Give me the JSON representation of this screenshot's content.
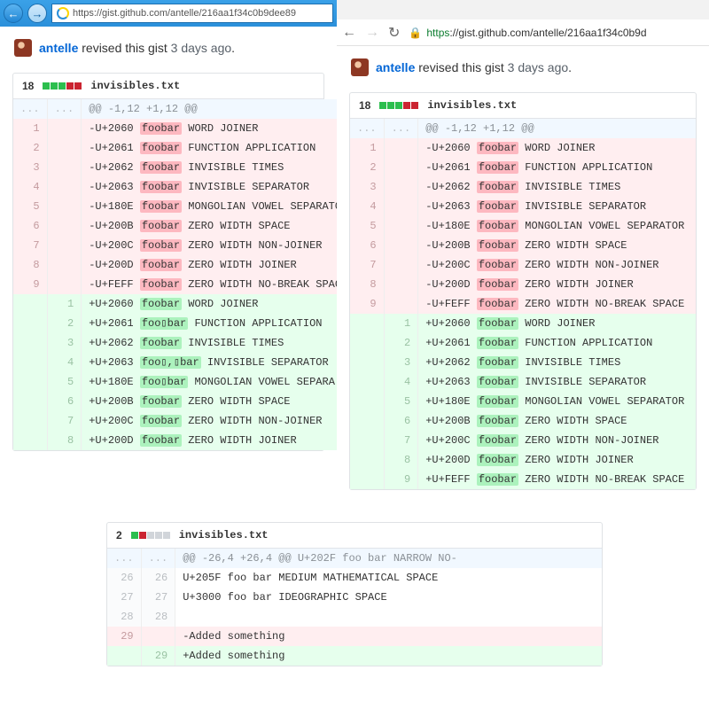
{
  "url_full": "https://gist.github.com/antelle/216aa1f34c0b9dee89",
  "url_partial": "https://gist.github.com/antelle/216aa1f34c0b9d",
  "author": "antelle",
  "revised_text": "revised",
  "gist_text": "this gist",
  "ago": "3 days ago",
  "dot": ".",
  "file1": {
    "stat": "18",
    "name": "invisibles.txt",
    "hunk": "@@ -1,12 +1,12 @@"
  },
  "del": [
    {
      "n": "1",
      "code": "U+2060",
      "label": "WORD JOINER"
    },
    {
      "n": "2",
      "code": "U+2061",
      "label": "FUNCTION APPLICATION"
    },
    {
      "n": "3",
      "code": "U+2062",
      "label": "INVISIBLE TIMES"
    },
    {
      "n": "4",
      "code": "U+2063",
      "label": "INVISIBLE SEPARATOR"
    },
    {
      "n": "5",
      "code": "U+180E",
      "label": "MONGOLIAN VOWEL SEPARATOR"
    },
    {
      "n": "6",
      "code": "U+200B",
      "label": "ZERO WIDTH SPACE"
    },
    {
      "n": "7",
      "code": "U+200C",
      "label": "ZERO WIDTH NON-JOINER"
    },
    {
      "n": "8",
      "code": "U+200D",
      "label": "ZERO WIDTH JOINER"
    },
    {
      "n": "9",
      "code": "U+FEFF",
      "label": "ZERO WIDTH NO-BREAK SPACE"
    }
  ],
  "add_left": [
    {
      "n": "1",
      "code": "U+2060",
      "tok": "foobar",
      "label": "WORD JOINER"
    },
    {
      "n": "2",
      "code": "U+2061",
      "tok": "foo▯bar",
      "label": "FUNCTION APPLICATION"
    },
    {
      "n": "3",
      "code": "U+2062",
      "tok": "foobar",
      "label": "INVISIBLE TIMES"
    },
    {
      "n": "4",
      "code": "U+2063",
      "tok": "foo▯,▯bar",
      "label": "INVISIBLE SEPARATOR"
    },
    {
      "n": "5",
      "code": "U+180E",
      "tok": "foo▯bar",
      "label": "MONGOLIAN VOWEL SEPARA"
    },
    {
      "n": "6",
      "code": "U+200B",
      "tok": "foobar",
      "label": "ZERO WIDTH SPACE"
    },
    {
      "n": "7",
      "code": "U+200C",
      "tok": "foobar",
      "label": "ZERO WIDTH NON-JOINER"
    },
    {
      "n": "8",
      "code": "U+200D",
      "tok": "foobar",
      "label": "ZERO WIDTH JOINER"
    }
  ],
  "add_right": [
    {
      "n": "1",
      "code": "U+2060",
      "label": "WORD JOINER"
    },
    {
      "n": "2",
      "code": "U+2061",
      "label": "FUNCTION APPLICATION"
    },
    {
      "n": "3",
      "code": "U+2062",
      "label": "INVISIBLE TIMES"
    },
    {
      "n": "4",
      "code": "U+2063",
      "label": "INVISIBLE SEPARATOR"
    },
    {
      "n": "5",
      "code": "U+180E",
      "label": "MONGOLIAN VOWEL SEPARATOR"
    },
    {
      "n": "6",
      "code": "U+200B",
      "label": "ZERO WIDTH SPACE"
    },
    {
      "n": "7",
      "code": "U+200C",
      "label": "ZERO WIDTH NON-JOINER"
    },
    {
      "n": "8",
      "code": "U+200D",
      "label": "ZERO WIDTH JOINER"
    },
    {
      "n": "9",
      "code": "U+FEFF",
      "label": "ZERO WIDTH NO-BREAK SPACE"
    }
  ],
  "foobar": "foobar",
  "file2": {
    "stat": "2",
    "name": "invisibles.txt",
    "hunk": "@@ -26,4 +26,4 @@ U+202F foo bar NARROW NO-",
    "rows_ctx": [
      {
        "a": "26",
        "b": "26",
        "text": " U+205F foo bar MEDIUM MATHEMATICAL SPACE"
      },
      {
        "a": "27",
        "b": "27",
        "text": " U+3000 foo  bar IDEOGRAPHIC SPACE"
      },
      {
        "a": "28",
        "b": "28",
        "text": " "
      }
    ],
    "del": {
      "a": "29",
      "text": "-Added something"
    },
    "add": {
      "b": "29",
      "text": "+Added something"
    }
  }
}
